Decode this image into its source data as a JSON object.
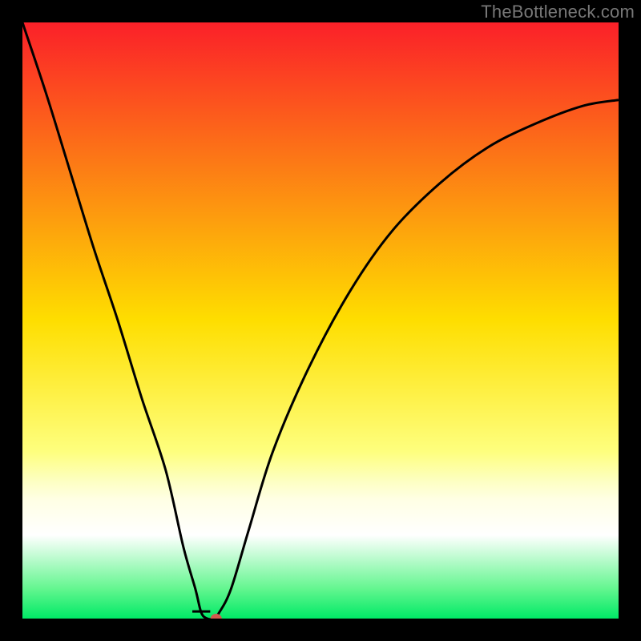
{
  "watermark": "TheBottleneck.com",
  "chart_data": {
    "type": "line",
    "title": "",
    "xlabel": "",
    "ylabel": "",
    "xlim": [
      0,
      100
    ],
    "ylim": [
      0,
      100
    ],
    "background": "rainbow-gradient",
    "gradient_stops": [
      {
        "pos": 0,
        "color": "#fb2029"
      },
      {
        "pos": 50,
        "color": "#fede00"
      },
      {
        "pos": 72,
        "color": "#feff7e"
      },
      {
        "pos": 77,
        "color": "#fdffc3"
      },
      {
        "pos": 80,
        "color": "#ffffe4"
      },
      {
        "pos": 86,
        "color": "#ffffff"
      },
      {
        "pos": 95,
        "color": "#63f68f"
      },
      {
        "pos": 100,
        "color": "#00e966"
      }
    ],
    "series": [
      {
        "name": "bottleneck-curve",
        "color": "#000000",
        "x": [
          0,
          4,
          8,
          12,
          16,
          20,
          24,
          27,
          29,
          30,
          31,
          32,
          33,
          35,
          38,
          42,
          48,
          55,
          62,
          70,
          78,
          86,
          94,
          100
        ],
        "y": [
          100,
          88,
          75,
          62,
          50,
          37,
          25,
          12,
          5,
          1,
          0,
          0,
          1,
          5,
          15,
          28,
          42,
          55,
          65,
          73,
          79,
          83,
          86,
          87
        ]
      }
    ],
    "marker": {
      "x": 32.5,
      "y": 0,
      "color": "#d25a4e",
      "radius": 6
    },
    "notch": {
      "x_left": 28.5,
      "x_right": 31.5,
      "y": 1.2
    }
  }
}
